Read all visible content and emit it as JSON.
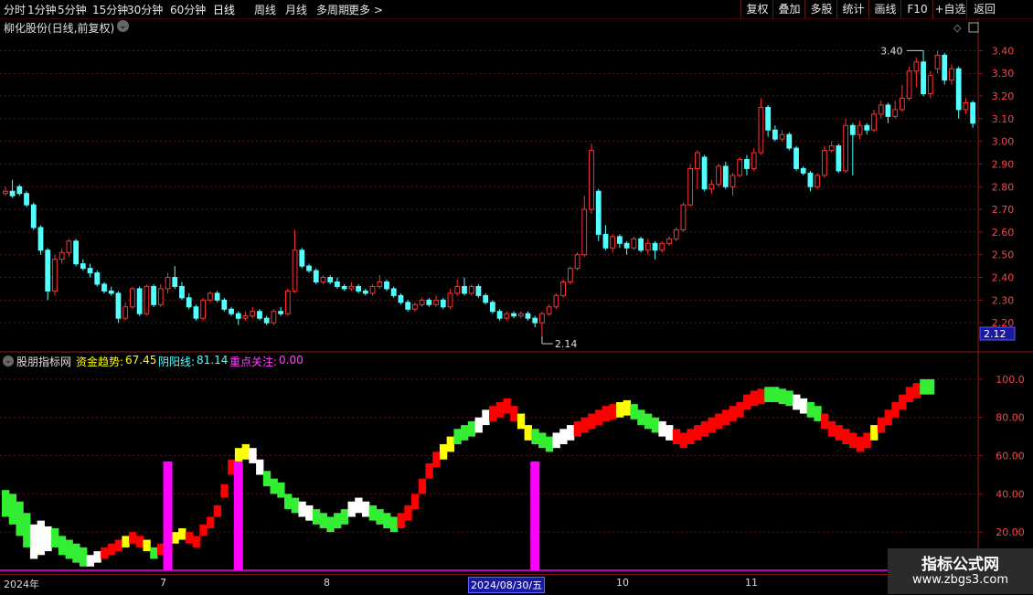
{
  "toolbar": {
    "periods": [
      "分时",
      "1分钟",
      "5分钟",
      "15分钟",
      "30分钟",
      "60分钟",
      "日线",
      "周线",
      "月线",
      "多周期",
      "更多 >"
    ],
    "active_period": "日线",
    "right_buttons": [
      "复权",
      "叠加",
      "多股",
      "统计",
      "画线",
      "F10",
      "+自选",
      "返回"
    ]
  },
  "main_chart": {
    "title": "柳化股份(日线,前复权)",
    "y_ticks": [
      "3.40",
      "3.30",
      "3.20",
      "3.10",
      "3.00",
      "2.90",
      "2.80",
      "2.70",
      "2.60",
      "2.50",
      "2.40",
      "2.30",
      "2.20"
    ],
    "current_price_badge": "2.12",
    "high_marker": "3.40",
    "low_marker": "2.14",
    "up_color": "#ff3232",
    "down_color": "#54ffff"
  },
  "indicator": {
    "name": "股朋指标网",
    "fund_trend_label": "资金趋势:",
    "fund_trend_value": "67.45",
    "yinyang_label": "阴阳线:",
    "yinyang_value": "81.14",
    "focus_label": "重点关注:",
    "focus_value": "0.00",
    "y_ticks": [
      "100.0",
      "80.00",
      "60.00",
      "40.00",
      "20.00"
    ],
    "colors": {
      "red": "#ff0000",
      "yellow": "#ffff00",
      "green": "#33ee33",
      "white": "#ffffff",
      "magenta": "#ff00ff"
    }
  },
  "x_axis": {
    "labels": [
      "2024年",
      "7",
      "8",
      "2024/08/30/五",
      "10",
      "11"
    ]
  },
  "chart_data": {
    "type": "candlestick",
    "title": "柳化股份(日线,前复权)",
    "ylim": [
      2.12,
      3.45
    ],
    "candles": [
      [
        2.77,
        2.78,
        2.8,
        2.76
      ],
      [
        2.78,
        2.76,
        2.83,
        2.75
      ],
      [
        2.8,
        2.77,
        2.81,
        2.76
      ],
      [
        2.77,
        2.72,
        2.78,
        2.71
      ],
      [
        2.72,
        2.62,
        2.73,
        2.61
      ],
      [
        2.62,
        2.52,
        2.63,
        2.5
      ],
      [
        2.52,
        2.34,
        2.53,
        2.3
      ],
      [
        2.34,
        2.48,
        2.5,
        2.32
      ],
      [
        2.48,
        2.51,
        2.53,
        2.46
      ],
      [
        2.51,
        2.56,
        2.57,
        2.49
      ],
      [
        2.56,
        2.46,
        2.57,
        2.45
      ],
      [
        2.46,
        2.44,
        2.48,
        2.43
      ],
      [
        2.44,
        2.42,
        2.46,
        2.4
      ],
      [
        2.42,
        2.37,
        2.43,
        2.36
      ],
      [
        2.37,
        2.34,
        2.38,
        2.33
      ],
      [
        2.34,
        2.33,
        2.36,
        2.32
      ],
      [
        2.33,
        2.22,
        2.34,
        2.2
      ],
      [
        2.22,
        2.27,
        2.29,
        2.21
      ],
      [
        2.27,
        2.35,
        2.36,
        2.26
      ],
      [
        2.35,
        2.24,
        2.36,
        2.23
      ],
      [
        2.24,
        2.36,
        2.37,
        2.23
      ],
      [
        2.36,
        2.28,
        2.37,
        2.27
      ],
      [
        2.28,
        2.35,
        2.37,
        2.27
      ],
      [
        2.35,
        2.4,
        2.42,
        2.33
      ],
      [
        2.4,
        2.36,
        2.45,
        2.35
      ],
      [
        2.36,
        2.31,
        2.38,
        2.3
      ],
      [
        2.31,
        2.27,
        2.33,
        2.26
      ],
      [
        2.27,
        2.22,
        2.28,
        2.21
      ],
      [
        2.22,
        2.3,
        2.31,
        2.21
      ],
      [
        2.3,
        2.33,
        2.34,
        2.29
      ],
      [
        2.33,
        2.3,
        2.34,
        2.29
      ],
      [
        2.3,
        2.26,
        2.31,
        2.25
      ],
      [
        2.26,
        2.24,
        2.27,
        2.23
      ],
      [
        2.24,
        2.22,
        2.25,
        2.19
      ],
      [
        2.22,
        2.23,
        2.25,
        2.21
      ],
      [
        2.23,
        2.25,
        2.27,
        2.22
      ],
      [
        2.25,
        2.22,
        2.26,
        2.21
      ],
      [
        2.22,
        2.2,
        2.23,
        2.19
      ],
      [
        2.2,
        2.25,
        2.26,
        2.19
      ],
      [
        2.25,
        2.24,
        2.27,
        2.23
      ],
      [
        2.24,
        2.34,
        2.35,
        2.23
      ],
      [
        2.34,
        2.52,
        2.61,
        2.33
      ],
      [
        2.52,
        2.45,
        2.53,
        2.44
      ],
      [
        2.45,
        2.43,
        2.46,
        2.42
      ],
      [
        2.43,
        2.38,
        2.44,
        2.37
      ],
      [
        2.38,
        2.4,
        2.41,
        2.37
      ],
      [
        2.4,
        2.38,
        2.41,
        2.37
      ],
      [
        2.38,
        2.36,
        2.4,
        2.35
      ],
      [
        2.36,
        2.35,
        2.37,
        2.34
      ],
      [
        2.35,
        2.36,
        2.38,
        2.34
      ],
      [
        2.36,
        2.34,
        2.37,
        2.33
      ],
      [
        2.34,
        2.33,
        2.35,
        2.32
      ],
      [
        2.33,
        2.36,
        2.37,
        2.32
      ],
      [
        2.36,
        2.38,
        2.41,
        2.35
      ],
      [
        2.38,
        2.35,
        2.39,
        2.34
      ],
      [
        2.35,
        2.32,
        2.36,
        2.31
      ],
      [
        2.32,
        2.29,
        2.33,
        2.28
      ],
      [
        2.29,
        2.26,
        2.3,
        2.25
      ],
      [
        2.26,
        2.28,
        2.29,
        2.25
      ],
      [
        2.28,
        2.3,
        2.31,
        2.27
      ],
      [
        2.3,
        2.28,
        2.31,
        2.27
      ],
      [
        2.28,
        2.3,
        2.32,
        2.27
      ],
      [
        2.3,
        2.27,
        2.31,
        2.26
      ],
      [
        2.27,
        2.33,
        2.35,
        2.26
      ],
      [
        2.33,
        2.36,
        2.39,
        2.32
      ],
      [
        2.36,
        2.33,
        2.4,
        2.32
      ],
      [
        2.33,
        2.36,
        2.37,
        2.32
      ],
      [
        2.36,
        2.32,
        2.37,
        2.31
      ],
      [
        2.32,
        2.29,
        2.33,
        2.28
      ],
      [
        2.29,
        2.25,
        2.3,
        2.24
      ],
      [
        2.25,
        2.22,
        2.26,
        2.21
      ],
      [
        2.22,
        2.24,
        2.25,
        2.21
      ],
      [
        2.24,
        2.23,
        2.25,
        2.22
      ],
      [
        2.23,
        2.24,
        2.25,
        2.22
      ],
      [
        2.24,
        2.22,
        2.25,
        2.21
      ],
      [
        2.22,
        2.2,
        2.23,
        2.18
      ],
      [
        2.2,
        2.24,
        2.25,
        2.14
      ],
      [
        2.24,
        2.27,
        2.28,
        2.23
      ],
      [
        2.27,
        2.32,
        2.33,
        2.26
      ],
      [
        2.32,
        2.38,
        2.39,
        2.31
      ],
      [
        2.38,
        2.44,
        2.45,
        2.37
      ],
      [
        2.44,
        2.5,
        2.51,
        2.43
      ],
      [
        2.5,
        2.7,
        2.76,
        2.49
      ],
      [
        2.7,
        2.96,
        2.99,
        2.68
      ],
      [
        2.78,
        2.59,
        2.79,
        2.56
      ],
      [
        2.59,
        2.53,
        2.63,
        2.52
      ],
      [
        2.53,
        2.58,
        2.59,
        2.51
      ],
      [
        2.58,
        2.55,
        2.59,
        2.53
      ],
      [
        2.55,
        2.53,
        2.56,
        2.5
      ],
      [
        2.53,
        2.57,
        2.58,
        2.52
      ],
      [
        2.57,
        2.52,
        2.58,
        2.51
      ],
      [
        2.52,
        2.55,
        2.57,
        2.5
      ],
      [
        2.55,
        2.52,
        2.56,
        2.48
      ],
      [
        2.52,
        2.55,
        2.56,
        2.51
      ],
      [
        2.55,
        2.57,
        2.58,
        2.54
      ],
      [
        2.57,
        2.61,
        2.62,
        2.56
      ],
      [
        2.61,
        2.72,
        2.73,
        2.6
      ],
      [
        2.72,
        2.88,
        2.9,
        2.71
      ],
      [
        2.88,
        2.95,
        2.96,
        2.79
      ],
      [
        2.93,
        2.79,
        2.94,
        2.78
      ],
      [
        2.79,
        2.81,
        2.83,
        2.77
      ],
      [
        2.81,
        2.89,
        2.9,
        2.8
      ],
      [
        2.89,
        2.8,
        2.91,
        2.79
      ],
      [
        2.8,
        2.85,
        2.86,
        2.76
      ],
      [
        2.85,
        2.92,
        2.93,
        2.84
      ],
      [
        2.92,
        2.88,
        2.94,
        2.85
      ],
      [
        2.88,
        2.95,
        2.97,
        2.87
      ],
      [
        2.95,
        3.15,
        3.19,
        2.94
      ],
      [
        3.15,
        3.05,
        3.16,
        3.02
      ],
      [
        3.05,
        3.01,
        3.07,
        3.0
      ],
      [
        3.01,
        3.03,
        3.05,
        3.0
      ],
      [
        3.03,
        2.97,
        3.04,
        2.96
      ],
      [
        2.97,
        2.88,
        2.98,
        2.87
      ],
      [
        2.88,
        2.86,
        2.89,
        2.85
      ],
      [
        2.86,
        2.8,
        2.87,
        2.78
      ],
      [
        2.8,
        2.85,
        2.86,
        2.79
      ],
      [
        2.85,
        2.96,
        2.98,
        2.84
      ],
      [
        2.96,
        2.98,
        3.0,
        2.95
      ],
      [
        2.98,
        2.87,
        2.99,
        2.86
      ],
      [
        2.87,
        3.07,
        3.1,
        2.86
      ],
      [
        3.07,
        3.03,
        3.08,
        2.85
      ],
      [
        3.03,
        3.07,
        3.09,
        3.01
      ],
      [
        3.07,
        3.05,
        3.08,
        3.03
      ],
      [
        3.05,
        3.12,
        3.14,
        3.04
      ],
      [
        3.12,
        3.16,
        3.18,
        3.1
      ],
      [
        3.16,
        3.11,
        3.17,
        3.08
      ],
      [
        3.11,
        3.14,
        3.18,
        3.1
      ],
      [
        3.14,
        3.19,
        3.25,
        3.13
      ],
      [
        3.19,
        3.31,
        3.33,
        3.18
      ],
      [
        3.31,
        3.35,
        3.37,
        3.24
      ],
      [
        3.35,
        3.21,
        3.4,
        3.2
      ],
      [
        3.21,
        3.29,
        3.31,
        3.19
      ],
      [
        3.32,
        3.38,
        3.4,
        3.3
      ],
      [
        3.38,
        3.27,
        3.39,
        3.25
      ],
      [
        3.27,
        3.32,
        3.34,
        3.25
      ],
      [
        3.32,
        3.14,
        3.33,
        3.1
      ],
      [
        3.14,
        3.17,
        3.19,
        3.12
      ],
      [
        3.17,
        3.08,
        3.18,
        3.06
      ]
    ],
    "indicator_bands": [
      {
        "from": 0,
        "to": 3,
        "color": "green"
      },
      {
        "from": 4,
        "to": 6,
        "color": "white"
      },
      {
        "from": 7,
        "to": 11,
        "color": "green"
      },
      {
        "from": 12,
        "to": 13,
        "color": "white"
      },
      {
        "from": 14,
        "to": 16,
        "color": "red"
      },
      {
        "from": 17,
        "to": 17,
        "color": "yellow"
      },
      {
        "from": 18,
        "to": 19,
        "color": "red"
      },
      {
        "from": 20,
        "to": 20,
        "color": "yellow"
      },
      {
        "from": 21,
        "to": 21,
        "color": "green"
      },
      {
        "from": 22,
        "to": 23,
        "color": "red"
      },
      {
        "from": 24,
        "to": 25,
        "color": "yellow"
      },
      {
        "from": 26,
        "to": 32,
        "color": "red"
      },
      {
        "from": 33,
        "to": 34,
        "color": "yellow"
      },
      {
        "from": 35,
        "to": 36,
        "color": "white"
      },
      {
        "from": 37,
        "to": 41,
        "color": "green"
      },
      {
        "from": 42,
        "to": 43,
        "color": "white"
      },
      {
        "from": 44,
        "to": 48,
        "color": "green"
      },
      {
        "from": 49,
        "to": 51,
        "color": "white"
      },
      {
        "from": 52,
        "to": 55,
        "color": "green"
      },
      {
        "from": 56,
        "to": 61,
        "color": "red"
      },
      {
        "from": 62,
        "to": 63,
        "color": "yellow"
      },
      {
        "from": 64,
        "to": 66,
        "color": "green"
      },
      {
        "from": 67,
        "to": 68,
        "color": "white"
      },
      {
        "from": 69,
        "to": 72,
        "color": "red"
      },
      {
        "from": 73,
        "to": 74,
        "color": "yellow"
      },
      {
        "from": 75,
        "to": 77,
        "color": "green"
      },
      {
        "from": 78,
        "to": 80,
        "color": "white"
      },
      {
        "from": 81,
        "to": 86,
        "color": "red"
      },
      {
        "from": 87,
        "to": 88,
        "color": "yellow"
      },
      {
        "from": 89,
        "to": 92,
        "color": "green"
      },
      {
        "from": 93,
        "to": 94,
        "color": "white"
      },
      {
        "from": 95,
        "to": 102,
        "color": "red"
      },
      {
        "from": 103,
        "to": 107,
        "color": "red"
      },
      {
        "from": 108,
        "to": 111,
        "color": "green"
      },
      {
        "from": 112,
        "to": 113,
        "color": "white"
      },
      {
        "from": 114,
        "to": 115,
        "color": "green"
      },
      {
        "from": 116,
        "to": 122,
        "color": "red"
      },
      {
        "from": 123,
        "to": 123,
        "color": "yellow"
      },
      {
        "from": 124,
        "to": 126,
        "color": "red"
      },
      {
        "from": 127,
        "to": 129,
        "color": "red"
      },
      {
        "from": 130,
        "to": 131,
        "color": "green"
      }
    ],
    "indicator_upper": [
      42,
      40,
      36,
      30,
      24,
      26,
      23,
      22,
      18,
      16,
      14,
      12,
      8,
      10,
      12,
      14,
      16,
      18,
      20,
      18,
      16,
      12,
      14,
      16,
      20,
      22,
      20,
      18,
      24,
      28,
      34,
      45,
      58,
      64,
      66,
      64,
      58,
      52,
      48,
      46,
      40,
      38,
      36,
      34,
      32,
      30,
      28,
      30,
      32,
      36,
      38,
      36,
      34,
      32,
      30,
      28,
      30,
      34,
      40,
      48,
      56,
      62,
      66,
      70,
      74,
      76,
      78,
      80,
      84,
      86,
      88,
      90,
      86,
      82,
      76,
      74,
      72,
      70,
      72,
      74,
      76,
      78,
      80,
      82,
      84,
      86,
      87,
      88,
      89,
      87,
      84,
      82,
      80,
      78,
      76,
      74,
      72,
      74,
      76,
      78,
      80,
      82,
      84,
      86,
      88,
      92,
      94,
      95,
      96,
      96,
      95,
      94,
      92,
      90,
      88,
      86,
      82,
      78,
      76,
      74,
      72,
      70,
      72,
      76,
      80,
      84,
      88,
      92,
      96,
      98,
      100,
      100
    ],
    "indicator_lower": [
      28,
      24,
      18,
      12,
      6,
      8,
      10,
      12,
      8,
      6,
      4,
      2,
      2,
      4,
      6,
      8,
      10,
      12,
      14,
      12,
      10,
      6,
      8,
      10,
      14,
      16,
      14,
      12,
      18,
      22,
      28,
      38,
      50,
      56,
      58,
      56,
      50,
      44,
      40,
      38,
      32,
      30,
      28,
      26,
      24,
      22,
      20,
      22,
      24,
      28,
      30,
      28,
      26,
      24,
      22,
      20,
      22,
      26,
      32,
      40,
      48,
      54,
      58,
      62,
      66,
      68,
      70,
      72,
      76,
      78,
      80,
      82,
      78,
      74,
      68,
      66,
      64,
      62,
      64,
      66,
      68,
      70,
      72,
      74,
      76,
      78,
      79,
      80,
      81,
      79,
      76,
      74,
      72,
      70,
      68,
      66,
      64,
      66,
      68,
      70,
      72,
      74,
      76,
      78,
      80,
      84,
      86,
      87,
      88,
      88,
      87,
      86,
      84,
      82,
      80,
      78,
      74,
      70,
      68,
      66,
      64,
      62,
      64,
      68,
      72,
      76,
      80,
      84,
      88,
      90,
      92,
      92
    ],
    "focus_bars": [
      23,
      33,
      75
    ],
    "indicator_ylim": [
      0,
      110
    ]
  }
}
